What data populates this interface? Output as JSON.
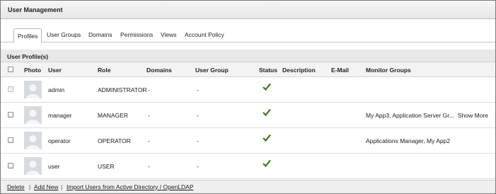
{
  "header": {
    "title": "User Management"
  },
  "tabs": [
    {
      "label": "Profiles",
      "active": true
    },
    {
      "label": "User Groups"
    },
    {
      "label": "Domains"
    },
    {
      "label": "Permissions"
    },
    {
      "label": "Views"
    },
    {
      "label": "Account Policy"
    }
  ],
  "section": {
    "title": "User Profile(s)"
  },
  "table": {
    "columns": {
      "photo": "Photo",
      "user": "User",
      "role": "Role",
      "domains": "Domains",
      "user_group": "User Group",
      "status": "Status",
      "description": "Description",
      "email": "E-Mail",
      "monitor_groups": "Monitor Groups"
    },
    "rows": [
      {
        "user": "admin",
        "role": "ADMINISTRATOR",
        "domains": "-",
        "user_group": "-",
        "status_icon": "check-icon",
        "monitor_groups": "",
        "show_more": "",
        "checkbox_enabled": false
      },
      {
        "user": "manager",
        "role": "MANAGER",
        "domains": "-",
        "user_group": "-",
        "status_icon": "check-icon",
        "monitor_groups": "My App3, Application Server Gr...",
        "show_more": "Show More",
        "checkbox_enabled": true
      },
      {
        "user": "operator",
        "role": "OPERATOR",
        "domains": "-",
        "user_group": "-",
        "status_icon": "check-icon",
        "monitor_groups": "Applications Manager, My App2",
        "show_more": "",
        "checkbox_enabled": true
      },
      {
        "user": "user",
        "role": "USER",
        "domains": "-",
        "user_group": "-",
        "status_icon": "check-icon",
        "monitor_groups": "",
        "show_more": "",
        "checkbox_enabled": true
      }
    ]
  },
  "footer": {
    "delete": "Delete",
    "sep": "|",
    "add_new": "Add New",
    "import": "Import Users from Active Directory / OpenLDAP"
  },
  "colors": {
    "status_check": "#3f7a1f",
    "avatar_bg": "#d7dbe0",
    "header_bg": "#e8e8e8"
  }
}
